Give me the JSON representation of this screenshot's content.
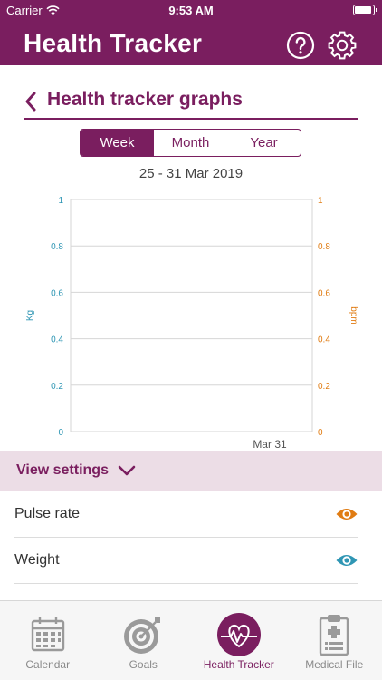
{
  "status_bar": {
    "carrier": "Carrier",
    "time": "9:53 AM"
  },
  "app_bar": {
    "title": "Health Tracker"
  },
  "sub_header": {
    "title": "Health tracker graphs"
  },
  "range_tabs": [
    {
      "label": "Week",
      "active": true
    },
    {
      "label": "Month",
      "active": false
    },
    {
      "label": "Year",
      "active": false
    }
  ],
  "date_range": "25 - 31 Mar 2019",
  "colors": {
    "brand": "#7a1e5f",
    "weight": "#2f96b4",
    "pulse": "#e07c13",
    "grid": "#d6d6d6"
  },
  "chart_data": {
    "type": "line",
    "title": "",
    "x": [
      "Mar 31"
    ],
    "x_tick_labels": [
      "Mar 31"
    ],
    "ylabel_left": "Kg",
    "ylabel_right": "bpm",
    "ylim_left": [
      0,
      1
    ],
    "ylim_right": [
      0,
      1
    ],
    "y_ticks_left": [
      "0",
      "0.2",
      "0.4",
      "0.6",
      "0.8",
      "1"
    ],
    "y_ticks_right": [
      "0",
      "0.2",
      "0.4",
      "0.6",
      "0.8",
      "1"
    ],
    "grid": true,
    "series": []
  },
  "view_settings": {
    "label": "View settings",
    "rows": [
      {
        "label": "Pulse rate",
        "icon": "eye-icon",
        "color": "#e07c13"
      },
      {
        "label": "Weight",
        "icon": "eye-icon",
        "color": "#2f96b4"
      }
    ]
  },
  "tab_bar": [
    {
      "label": "Calendar",
      "icon": "calendar-icon",
      "active": false
    },
    {
      "label": "Goals",
      "icon": "target-icon",
      "active": false
    },
    {
      "label": "Health Tracker",
      "icon": "heart-pulse-icon",
      "active": true
    },
    {
      "label": "Medical File",
      "icon": "clipboard-medical-icon",
      "active": false
    }
  ]
}
